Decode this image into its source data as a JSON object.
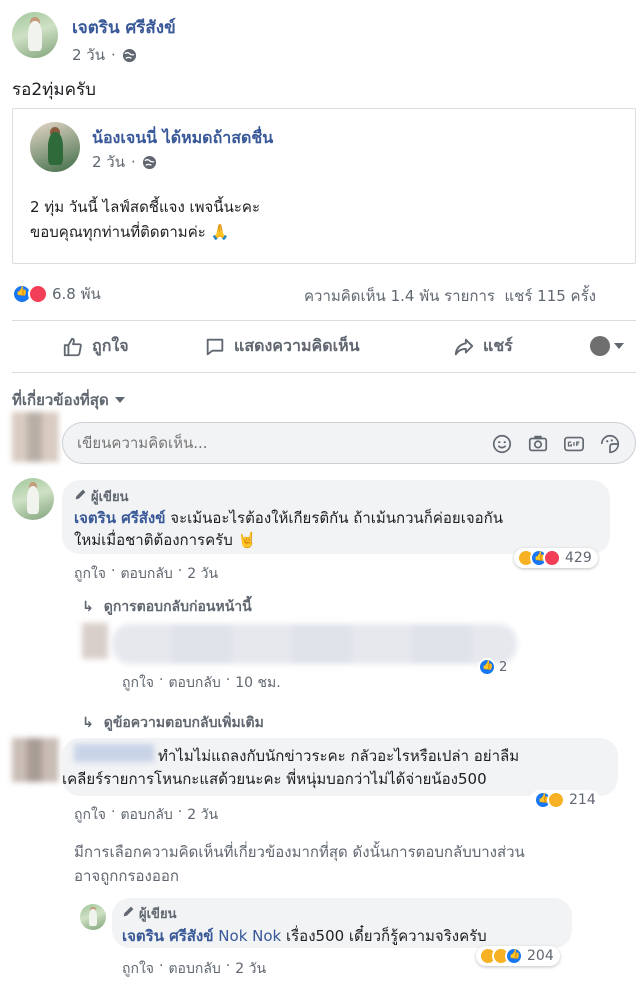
{
  "post": {
    "author": "เจตริน ศรีสังข์",
    "time": "2 วัน",
    "privacy_icon": "globe-icon",
    "text": "รอ2ทุ่มครับ"
  },
  "shared": {
    "author": "น้องเจนนี่ ได้หมดถ้าสดชื่น",
    "time": "2 วัน",
    "line1": "2 ทุ่ม วันนี้ ไลฟ์สดชี้แจง เพจนี้นะคะ",
    "line2": "ขอบคุณทุกท่านที่ติดตามค่ะ 🙏"
  },
  "stats": {
    "reactions_count": "6.8 พัน",
    "comments_shares": "ความคิดเห็น 1.4 พัน รายการ  แชร์ 115 ครั้ง"
  },
  "actions": {
    "like": "ถูกใจ",
    "comment": "แสดงความคิดเห็น",
    "share": "แชร์"
  },
  "filter": {
    "label": "ที่เกี่ยวข้องที่สุด"
  },
  "composer": {
    "placeholder": "เขียนความคิดเห็น..."
  },
  "comments": {
    "c1": {
      "badge": "ผู้เขียน",
      "author": "เจตริน ศรีสังข์",
      "text_line1": " จะเม้นอะไรต้องให้เกียรติกัน ถ้าเม้นกวนก็ค่อยเจอกัน",
      "text_line2": "ใหม่เมื่อชาติต้องการครับ 🤘",
      "like": "ถูกใจ",
      "reply": "ตอบกลับ",
      "time": "2 วัน",
      "reactions": "429",
      "prev_replies": "ดูการตอบกลับก่อนหน้านี้"
    },
    "r1": {
      "like": "ถูกใจ",
      "reply": "ตอบกลับ",
      "time": "10 ชม.",
      "reactions": "2"
    },
    "more_replies": "ดูข้อความตอบกลับเพิ่มเติม",
    "c2": {
      "text_line1": "ทำไมไม่แถลงกับนักข่าวระคะ กลัวอะไรหรือเปล่า อย่าลืม",
      "text_line2": "เคลียร์รายการโหนกะแสด้วยนะคะ พี่หนุ่มบอกว่าไม่ได้จ่ายน้อง500",
      "like": "ถูกใจ",
      "reply": "ตอบกลับ",
      "time": "2 วัน",
      "reactions": "214"
    },
    "notice_line1": "มีการเลือกความคิดเห็นที่เกี่ยวข้องมากที่สุด ดังนั้นการตอบกลับบางส่วน",
    "notice_line2": "อาจถูกกรองออก",
    "r2": {
      "badge": "ผู้เขียน",
      "author": "เจตริน ศรีสังข์",
      "mention": "Nok Nok",
      "text": " เรื่อง500 เดี๋ยวก็รู้ความจริงครับ",
      "like": "ถูกใจ",
      "reply": "ตอบกลับ",
      "time": "2 วัน",
      "reactions": "204"
    }
  },
  "colors": {
    "link": "#385898",
    "meta": "#606770",
    "bubble": "#f2f3f5",
    "like_blue": "#1877f2",
    "love_red": "#f33e58"
  }
}
